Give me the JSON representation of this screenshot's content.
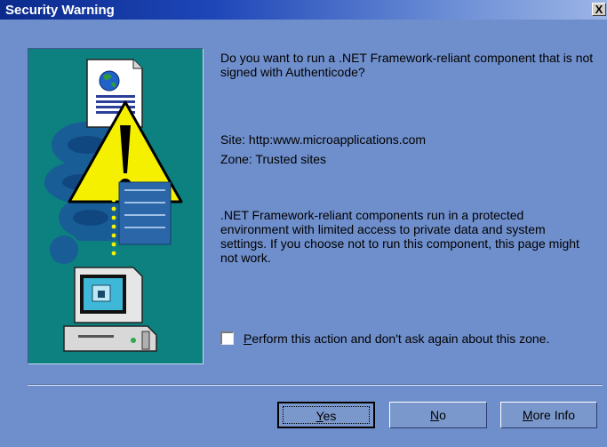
{
  "window": {
    "title": "Security Warning",
    "close_label": "X"
  },
  "message": {
    "question": "Do you want to run a .NET Framework-reliant component that is not signed with Authenticode?",
    "site": "Site: http:www.microapplications.com",
    "zone": "Zone: Trusted sites",
    "explanation": ".NET Framework-reliant components run in a protected environment with limited access to private data and system settings.  If you choose not to run this component, this page might not work."
  },
  "checkbox": {
    "checked": false,
    "label_first": "P",
    "label_rest": "erform this action and don't ask again about this zone."
  },
  "buttons": {
    "yes_first": "Y",
    "yes_rest": "es",
    "no_first": "N",
    "no_rest": "o",
    "more_first": "M",
    "more_rest": "ore Info"
  },
  "colors": {
    "dialog_background": "#6f8fcc",
    "titlebar_start": "#0b2a8c",
    "illustration_background": "#0d8080"
  },
  "icons": {
    "illustration": "security-warning-illustration",
    "document": "document-icon",
    "globe": "globe-icon",
    "warning": "warning-icon",
    "computer": "computer-icon"
  }
}
